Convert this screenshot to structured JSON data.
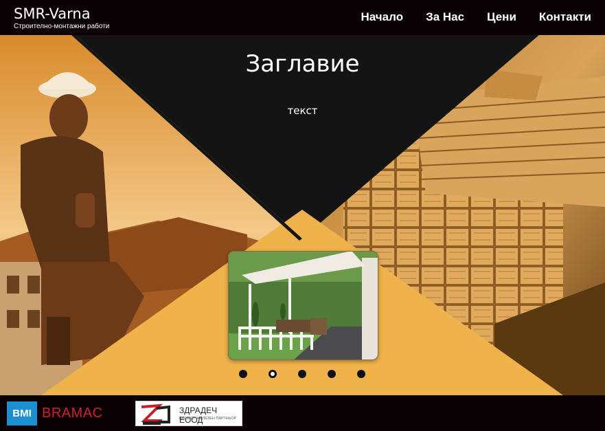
{
  "header": {
    "brand_name": "SMR-Varna",
    "brand_tagline": "Строително-монтажни работи",
    "nav": [
      "Начало",
      "За Нас",
      "Цени",
      "Контакти"
    ]
  },
  "hero": {
    "title": "Заглавие",
    "text": "текст",
    "slides_count": 5,
    "active_slide": 2
  },
  "footer": {
    "partner1": {
      "badge": "BMI",
      "name": "BRAMAC"
    },
    "partner2": {
      "mark": "ZD",
      "name": "ЗДРАДЕЧ ЕООД",
      "subtitle": "ВАШИЯТ ЖЕЛЕЗЕН ПАРТНЬОР"
    }
  },
  "colors": {
    "accent": "#f0b24a",
    "dark": "#141414",
    "header_bg": "#0b0205"
  }
}
